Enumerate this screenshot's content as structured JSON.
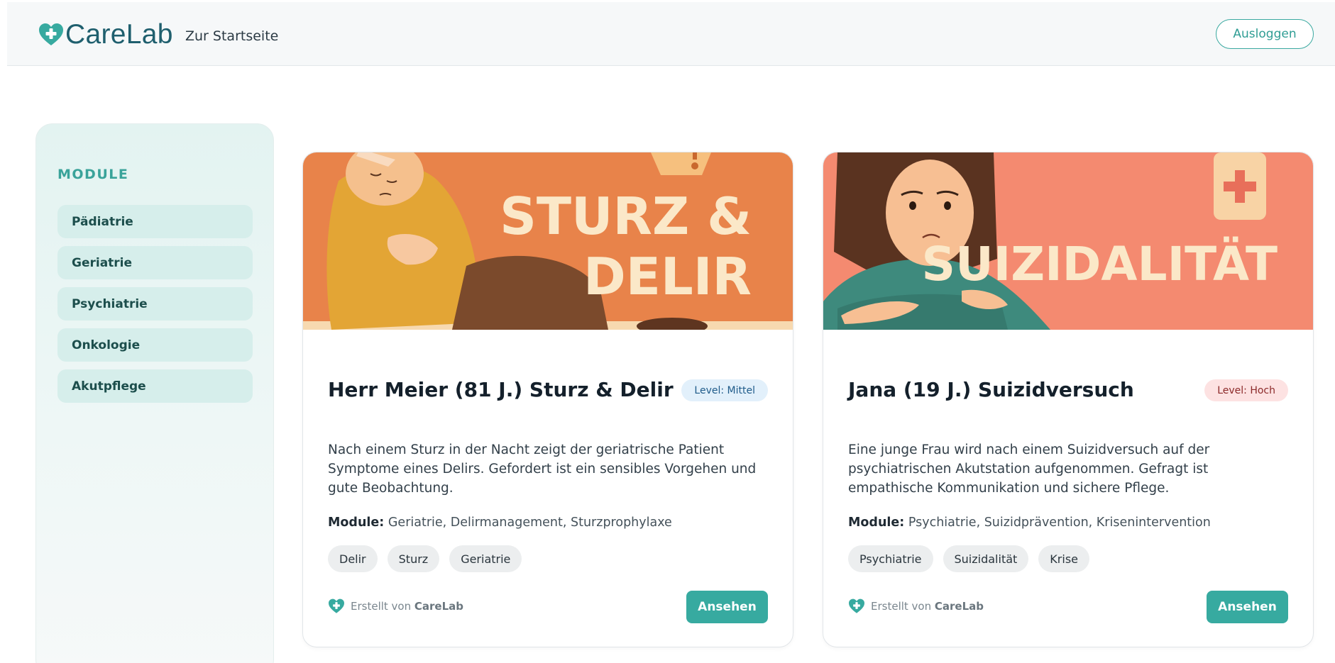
{
  "header": {
    "brand": "CareLab",
    "home_link": "Zur Startseite",
    "logout": "Ausloggen"
  },
  "sidebar": {
    "title": "MODULE",
    "items": [
      {
        "label": "Pädiatrie"
      },
      {
        "label": "Geriatrie"
      },
      {
        "label": "Psychiatrie"
      },
      {
        "label": "Onkologie"
      },
      {
        "label": "Akutpflege"
      }
    ]
  },
  "cards": [
    {
      "banner_text_1": "STURZ &",
      "banner_text_2": "DELIR",
      "title": "Herr Meier (81 J.) Sturz & Delir",
      "level": "Level: Mittel",
      "description": "Nach einem Sturz in der Nacht zeigt der geriatrische Patient Symptome eines Delirs. Gefordert ist ein sensibles Vorgehen und gute Beobachtung.",
      "modules_label": "Module:",
      "modules": "Geriatrie, Delirmanagement, Sturzprophylaxe",
      "tags": [
        "Delir",
        "Sturz",
        "Geriatrie"
      ],
      "created_by_prefix": "Erstellt von",
      "created_by": "CareLab",
      "button": "Ansehen"
    },
    {
      "banner_text_1": "SUIZIDALITÄT",
      "title": "Jana (19 J.) Suizidversuch",
      "level": "Level: Hoch",
      "description": "Eine junge Frau wird nach einem Suizidversuch auf der psychiatrischen Akutstation aufgenommen. Gefragt ist empathische Kommunikation und sichere Pflege.",
      "modules_label": "Module:",
      "modules": "Psychiatrie, Suizidprävention, Krisenintervention",
      "tags": [
        "Psychiatrie",
        "Suizidalität",
        "Krise"
      ],
      "created_by_prefix": "Erstellt von",
      "created_by": "CareLab",
      "button": "Ansehen"
    }
  ],
  "colors": {
    "accent": "#37aaa0",
    "brand": "#1f5f6e",
    "banner_orange": "#e8834a",
    "banner_salmon": "#f48a70"
  },
  "icons": [
    "heart-plus-icon"
  ]
}
